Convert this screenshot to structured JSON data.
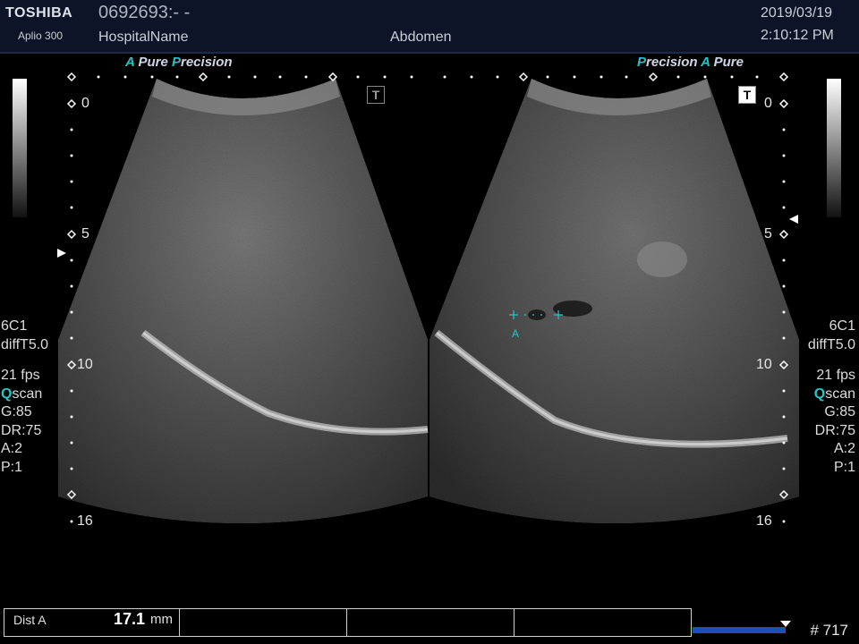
{
  "header": {
    "brand": "TOSHIBA",
    "model": "Aplio 300",
    "patient_id": "0692693:- -",
    "hospital": "HospitalName",
    "preset": "Abdomen",
    "date": "2019/03/19",
    "time": "2:10:12 PM"
  },
  "images": {
    "left_label": {
      "a": "A",
      "pure": "Pure",
      "p": "P",
      "precision": "recision"
    },
    "right_label": {
      "p": "P",
      "precision": "recision",
      "a": "A",
      "pure": "Pure"
    },
    "t_marker": "T",
    "depth_ticks": [
      "0",
      "5",
      "10",
      "16"
    ]
  },
  "params": {
    "probe": "6C1",
    "mode": "diffT5.0",
    "fps": "21 fps",
    "qscan_q": "Q",
    "qscan_rest": "scan",
    "gain": "G:85",
    "dr": "DR:75",
    "a": "A:2",
    "p": "P:1"
  },
  "caliper": {
    "label": "A"
  },
  "measurement": {
    "name": "Dist A",
    "value": "17.1",
    "unit": "mm"
  },
  "cine": {
    "progress_fraction": 1.0,
    "frame": "# 717"
  },
  "colors": {
    "accent": "#1fc6c6",
    "header_bg": "#0d1427",
    "progress": "#1a50b8"
  }
}
